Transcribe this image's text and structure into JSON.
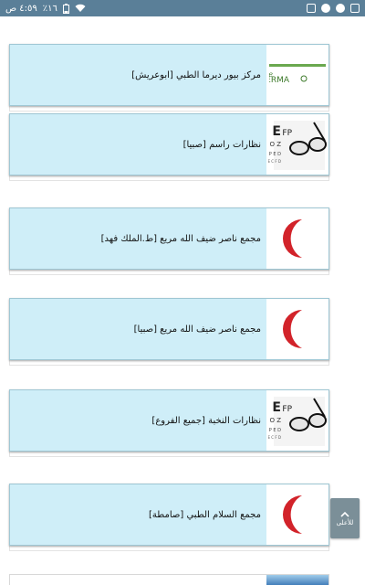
{
  "status_bar": {
    "time": "٤:٥٩ ص",
    "battery": "٪١٦"
  },
  "cards": [
    {
      "label": "مركز بيور ديرما الطبي [ابوعريش]",
      "thumb": "derma-logo",
      "logo_text": "DERMA"
    },
    {
      "label": "نظارات راسم [صبيا]",
      "thumb": "eye-chart-glasses-icon"
    },
    {
      "label": "مجمع ناصر ضيف الله مريع [ط.الملك فهد]",
      "thumb": "red-crescent-icon"
    },
    {
      "label": "مجمع ناصر ضيف الله مريع [صبيا]",
      "thumb": "red-crescent-icon"
    },
    {
      "label": "نظارات النخبة [جميع الفروع]",
      "thumb": "eye-chart-glasses-icon"
    },
    {
      "label": "مجمع السلام الطبي [صامطة]",
      "thumb": "red-crescent-icon"
    }
  ],
  "scroll_top_button": {
    "label": "للأعلى"
  },
  "colors": {
    "status_bar": "#5a7f98",
    "card_bg": "#cfeef8",
    "crescent": "#d2232a",
    "up_button": "#7b8f98"
  }
}
